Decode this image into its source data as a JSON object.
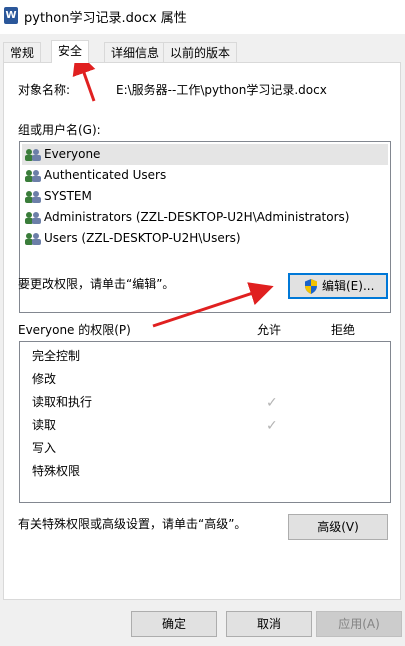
{
  "window": {
    "title": "python学习记录.docx 属性",
    "icon_name": "word-doc-icon"
  },
  "tabs": [
    {
      "label": "常规",
      "active": false
    },
    {
      "label": "安全",
      "active": true
    },
    {
      "label": "详细信息",
      "active": false
    },
    {
      "label": "以前的版本",
      "active": false
    }
  ],
  "security": {
    "object_name_label": "对象名称:",
    "object_name_value": "E:\\服务器--工作\\python学习记录.docx",
    "group_label": "组或用户名(G):",
    "users": [
      {
        "name": "Everyone",
        "selected": true
      },
      {
        "name": "Authenticated Users",
        "selected": false
      },
      {
        "name": "SYSTEM",
        "selected": false
      },
      {
        "name": "Administrators (ZZL-DESKTOP-U2H\\Administrators)",
        "selected": false
      },
      {
        "name": "Users (ZZL-DESKTOP-U2H\\Users)",
        "selected": false
      }
    ],
    "change_hint": "要更改权限，请单击“编辑”。",
    "edit_button": "编辑(E)...",
    "perm_header": "Everyone 的权限(P)",
    "allow_label": "允许",
    "deny_label": "拒绝",
    "permissions": [
      {
        "name": "完全控制",
        "allow": false,
        "deny": false
      },
      {
        "name": "修改",
        "allow": false,
        "deny": false
      },
      {
        "name": "读取和执行",
        "allow": true,
        "deny": false
      },
      {
        "name": "读取",
        "allow": true,
        "deny": false
      },
      {
        "name": "写入",
        "allow": false,
        "deny": false
      },
      {
        "name": "特殊权限",
        "allow": false,
        "deny": false
      }
    ],
    "advanced_hint": "有关特殊权限或高级设置，请单击“高级”。",
    "advanced_button": "高级(V)"
  },
  "footer": {
    "ok": "确定",
    "cancel": "取消",
    "apply": "应用(A)"
  },
  "colors": {
    "accent": "#0078d7",
    "annotation_arrow": "#e02020"
  }
}
